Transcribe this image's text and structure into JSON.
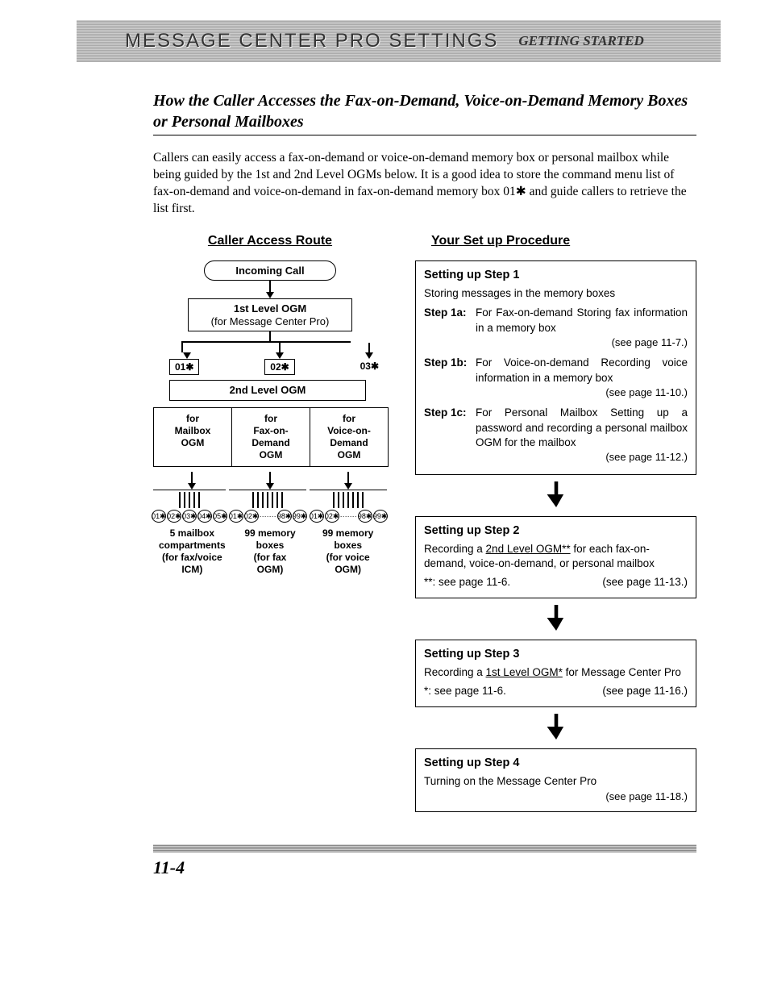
{
  "header": {
    "title": "MESSAGE CENTER PRO SETTINGS",
    "subtitle": "GETTING STARTED"
  },
  "section_title": "How the Caller Accesses the Fax-on-Demand, Voice-on-Demand Memory Boxes or Personal Mailboxes",
  "intro": "Callers can easily access a fax-on-demand or voice-on-demand memory box or personal mailbox while being guided by the 1st and 2nd Level OGMs below. It is a good idea to store the command menu list of fax-on-demand and voice-on-demand in fax-on-demand memory box 01✱ and guide callers to retrieve the list first.",
  "flow": {
    "heading": "Caller Access Route",
    "incoming": "Incoming Call",
    "ogm1_l1": "1st Level OGM",
    "ogm1_l2": "(for Message Center Pro)",
    "codes": {
      "a": "01✱",
      "b": "02✱",
      "c": "03✱"
    },
    "ogm2": "2nd Level OGM",
    "trio": {
      "a1": "for",
      "a2": "Mailbox",
      "a3": "OGM",
      "b1": "for",
      "b2": "Fax-on-",
      "b3": "Demand",
      "b4": "OGM",
      "c1": "for",
      "c2": "Voice-on-",
      "c3": "Demand",
      "c4": "OGM"
    },
    "circlesA": [
      "01✱",
      "02✱",
      "03✱",
      "04✱",
      "05✱"
    ],
    "circlesB": [
      "01✱",
      "02✱",
      "98✱",
      "99✱"
    ],
    "circlesC": [
      "01✱",
      "02✱",
      "98✱",
      "99✱"
    ],
    "cap": {
      "a1": "5 mailbox",
      "a2": "compartments",
      "a3": "(for fax/voice",
      "a4": "ICM)",
      "b1": "99 memory",
      "b2": "boxes",
      "b3": "(for fax",
      "b4": "OGM)",
      "c1": "99 memory",
      "c2": "boxes",
      "c3": "(for voice",
      "c4": "OGM)"
    }
  },
  "setup": {
    "heading": "Your Set up Procedure",
    "step1": {
      "title": "Setting up Step 1",
      "sub": "Storing messages in the memory boxes",
      "a_label": "Step 1a:",
      "a_body": "For Fax-on-demand Storing fax information in a memory box",
      "a_ref": "(see page 11-7.)",
      "b_label": "Step 1b:",
      "b_body": "For Voice-on-demand Recording voice information in a memory box",
      "b_ref": "(see page 11-10.)",
      "c_label": "Step 1c:",
      "c_body": "For Personal Mailbox Setting up a password and recording a personal mailbox OGM for the mailbox",
      "c_ref": "(see page 11-12.)"
    },
    "step2": {
      "title": "Setting up Step 2",
      "body_pre": "Recording a ",
      "body_u": "2nd Level OGM**",
      "body_post": " for each fax-on-demand, voice-on-demand, or personal mailbox",
      "note": "**: see page 11-6.",
      "ref": "(see page 11-13.)"
    },
    "step3": {
      "title": "Setting up Step 3",
      "body_pre": "Recording a ",
      "body_u": "1st Level OGM*",
      "body_post": " for Message Center Pro",
      "note": "*: see page 11-6.",
      "ref": "(see page 11-16.)"
    },
    "step4": {
      "title": "Setting up Step 4",
      "body": "Turning on the Message Center Pro",
      "ref": "(see page 11-18.)"
    }
  },
  "page_number": "11-4"
}
